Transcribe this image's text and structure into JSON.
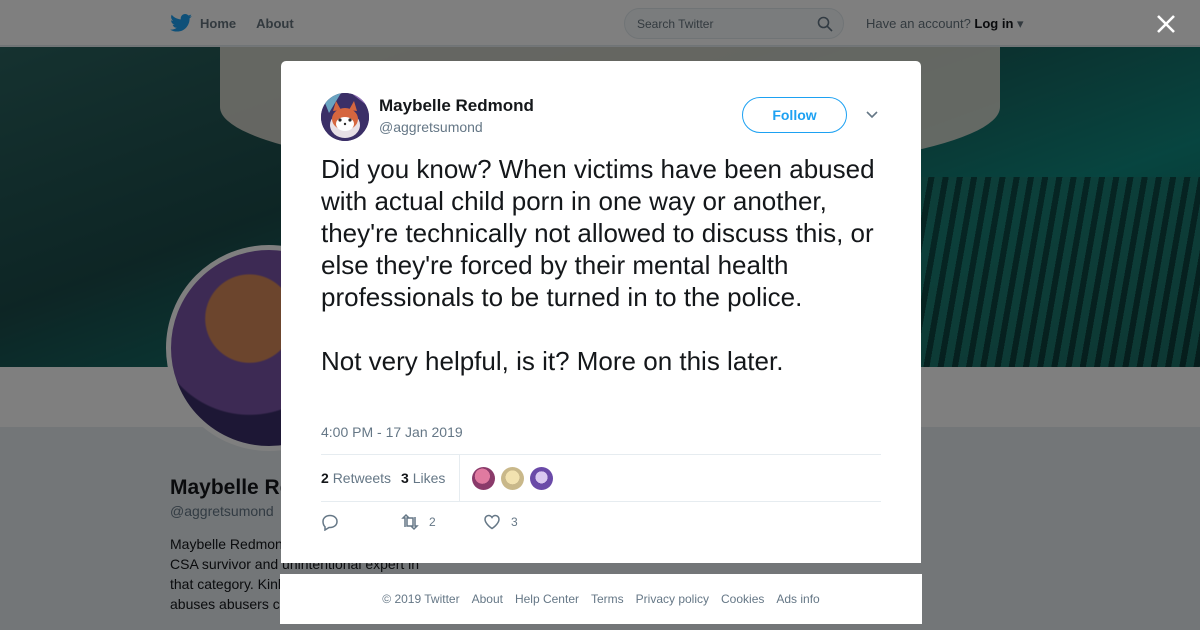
{
  "nav": {
    "home_label": "Home",
    "about_label": "About",
    "search_placeholder": "Search Twitter",
    "account_prompt": "Have an account?",
    "login_label": "Log in"
  },
  "profile": {
    "name": "Maybelle Re",
    "handle": "@aggretsumond",
    "bio_lines": [
      "Maybelle Redmon",
      "CSA survivor and unintentional expert in",
      "that category. Kinl",
      "abuses abusers c"
    ]
  },
  "tweet": {
    "author_name": "Maybelle Redmond",
    "author_handle": "@aggretsumond",
    "follow_label": "Follow",
    "text": "Did you know? When victims have been abused with actual child porn in one way or another, they're technically not allowed to discuss this, or else they're forced by their mental health professionals to be turned in to the police.\n\nNot very helpful, is it? More on this later.",
    "timestamp": "4:00 PM - 17 Jan 2019",
    "retweets_count": "2",
    "retweets_label": "Retweets",
    "likes_count": "3",
    "likes_label": "Likes",
    "reply_count": "",
    "retweet_action_count": "2",
    "like_action_count": "3"
  },
  "footer": {
    "links": [
      "© 2019 Twitter",
      "About",
      "Help Center",
      "Terms",
      "Privacy policy",
      "Cookies",
      "Ads info"
    ]
  },
  "colors": {
    "accent": "#1da1f2",
    "secondary_text": "#657786",
    "overlay": "rgba(0,0,0,0.5)"
  },
  "icons": [
    "twitter-bird-icon",
    "search-icon",
    "caret-down-icon",
    "close-icon",
    "chevron-down-icon",
    "reply-icon",
    "retweet-icon",
    "heart-icon"
  ]
}
